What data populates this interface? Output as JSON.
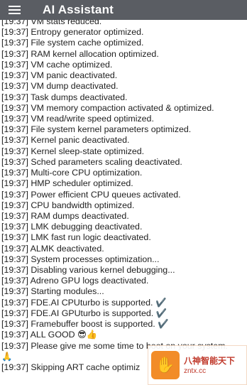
{
  "toolbar": {
    "menu_icon": "hamburger-menu-icon",
    "title": "AI Assistant",
    "background": "#5a5d63"
  },
  "log": [
    "[19:37]  VM stats reduced.",
    "[19:37]  Entropy generator optimized.",
    "[19:37]  File system cache optimized.",
    "[19:37]  RAM kernel allocation optimized.",
    "[19:37]  VM cache optimized.",
    "[19:37]  VM panic deactivated.",
    "[19:37]  VM dump deactivated.",
    "[19:37]  Task dumps deactivated.",
    "[19:37]  VM memory compaction activated & optimized.",
    "[19:37]  VM read/write speed optimized.",
    "[19:37]  File system kernel parameters optimized.",
    "[19:37]  Kernel panic deactivated.",
    "[19:37]  Kernel sleep-state optimized.",
    "[19:37]  Sched parameters scaling deactivated.",
    "[19:37]  Multi-core CPU optimization.",
    "[19:37]  HMP scheduler optimized.",
    "[19:37]  Power efficient CPU queues activated.",
    "[19:37]  CPU bandwidth optimized.",
    "[19:37]  RAM dumps deactivated.",
    "[19:37]  LMK debugging deactivated.",
    "[19:37]  LMK fast run logic deactivated.",
    "[19:37]  ALMK deactivated.",
    "[19:37]  System processes optimization...",
    "[19:37]  Disabling various kernel debugging...",
    "[19:37]  Adreno GPU logs deactivated.",
    "[19:37]  Starting modules...",
    "[19:37]  FDE.AI CPUturbo is supported. ✔️",
    "[19:37]  FDE.AI GPUturbo is supported. ✔️",
    "[19:37]  Framebuffer boost is supported. ✔️",
    "[19:37]  ALL GOOD 😎👍",
    "[19:37]  Please give me some time to boot on your system.",
    "🙏",
    "[19:37]  Skipping ART cache optimiz"
  ],
  "watermark": {
    "cn": "八神智能天下",
    "url": "zntx.cc",
    "logo_icon": "hand-logo-icon"
  }
}
